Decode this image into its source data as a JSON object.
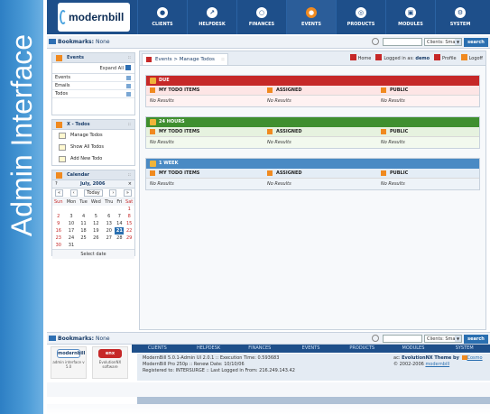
{
  "banner": {
    "text": "Admin Interface"
  },
  "logo": {
    "text": "modernbill"
  },
  "nav": [
    {
      "label": "CLIENTS",
      "icon": "users-icon",
      "glyph": "●"
    },
    {
      "label": "HELPDESK",
      "icon": "helpdesk-icon",
      "glyph": "↗"
    },
    {
      "label": "FINANCES",
      "icon": "finances-icon",
      "glyph": "○"
    },
    {
      "label": "EVENTS",
      "icon": "events-icon",
      "glyph": "●"
    },
    {
      "label": "PRODUCTS",
      "icon": "products-icon",
      "glyph": "◎"
    },
    {
      "label": "MODULES",
      "icon": "modules-icon",
      "glyph": "▣"
    },
    {
      "label": "SYSTEM",
      "icon": "system-icon",
      "glyph": "⚙"
    }
  ],
  "bookmarks": {
    "label": "Bookmarks:",
    "value": "None"
  },
  "search": {
    "placeholder": "",
    "scope": "Clients: Smart",
    "button": "search"
  },
  "events_panel": {
    "title": "Events",
    "expand_all": "Expand All",
    "rows": [
      "Events",
      "Emails",
      "Todos"
    ]
  },
  "todos_panel": {
    "title": "X - Todos",
    "items": [
      "Manage Todos",
      "Show All Todos",
      "Add New Todo"
    ]
  },
  "calendar": {
    "title": "Calendar",
    "month": "July, 2006",
    "today": "Today",
    "prev_year": "«",
    "prev": "‹",
    "next": "›",
    "next_year": "»",
    "question": "?",
    "days": [
      "Sun",
      "Mon",
      "Tue",
      "Wed",
      "Thu",
      "Fri",
      "Sat"
    ],
    "weeks": [
      [
        "",
        "",
        "",
        "",
        "",
        "",
        "1"
      ],
      [
        "2",
        "3",
        "4",
        "5",
        "6",
        "7",
        "8"
      ],
      [
        "9",
        "10",
        "11",
        "12",
        "13",
        "14",
        "15"
      ],
      [
        "16",
        "17",
        "18",
        "19",
        "20",
        "21",
        "22"
      ],
      [
        "23",
        "24",
        "25",
        "26",
        "27",
        "28",
        "29"
      ],
      [
        "30",
        "31",
        "",
        "",
        "",
        "",
        ""
      ]
    ],
    "selected": "21",
    "footer": "Select date"
  },
  "tab": {
    "label": "Events > Manage Todos"
  },
  "util": {
    "home": "Home",
    "logged_in_prefix": "Logged in as:",
    "user": "demo",
    "profile": "Profile",
    "logoff": "Logoff"
  },
  "groups": [
    {
      "title": "DUE",
      "color": "#c62828",
      "columns": [
        "MY TODO ITEMS",
        "ASSIGNED",
        "PUBLIC"
      ],
      "values": [
        "No Results",
        "No Results",
        "No Results"
      ]
    },
    {
      "title": "24 HOURS",
      "color": "#3f8f2f",
      "columns": [
        "MY TODO ITEMS",
        "ASSIGNED",
        "PUBLIC"
      ],
      "values": [
        "No Results",
        "No Results",
        "No Results"
      ]
    },
    {
      "title": "1 WEEK",
      "color": "#4a8ac4",
      "columns": [
        "MY TODO ITEMS",
        "ASSIGNED",
        "PUBLIC"
      ],
      "values": [
        "No Results",
        "No Results",
        "No Results"
      ]
    }
  ],
  "footer_nav": [
    "CLIENTS",
    "HELPDESK",
    "FINANCES",
    "EVENTS",
    "PRODUCTS",
    "MODULES",
    "SYSTEM"
  ],
  "footer": {
    "mb_logo": "modernbill",
    "mb_caption": "admin interface v 5.0",
    "nx_logo": "enx",
    "nx_caption": "EvolutionNX software",
    "info_line1": "ModernBill 5.0.1-Admin UI 2.0.1 :: Execution Time: 0.593683",
    "info_line2": "ModernBill Pro 250p :: Renew Date: 10/10/06",
    "info_line3": "Registered to: INTERSURGE :: Last Logged in From: 216.249.143.42",
    "theme_prefix": "ac:",
    "theme_name": "EvolutionNX Theme by",
    "theme_author": "Cosmo",
    "copyright": "© 2002-2006",
    "copyright_link": "modernbill"
  }
}
